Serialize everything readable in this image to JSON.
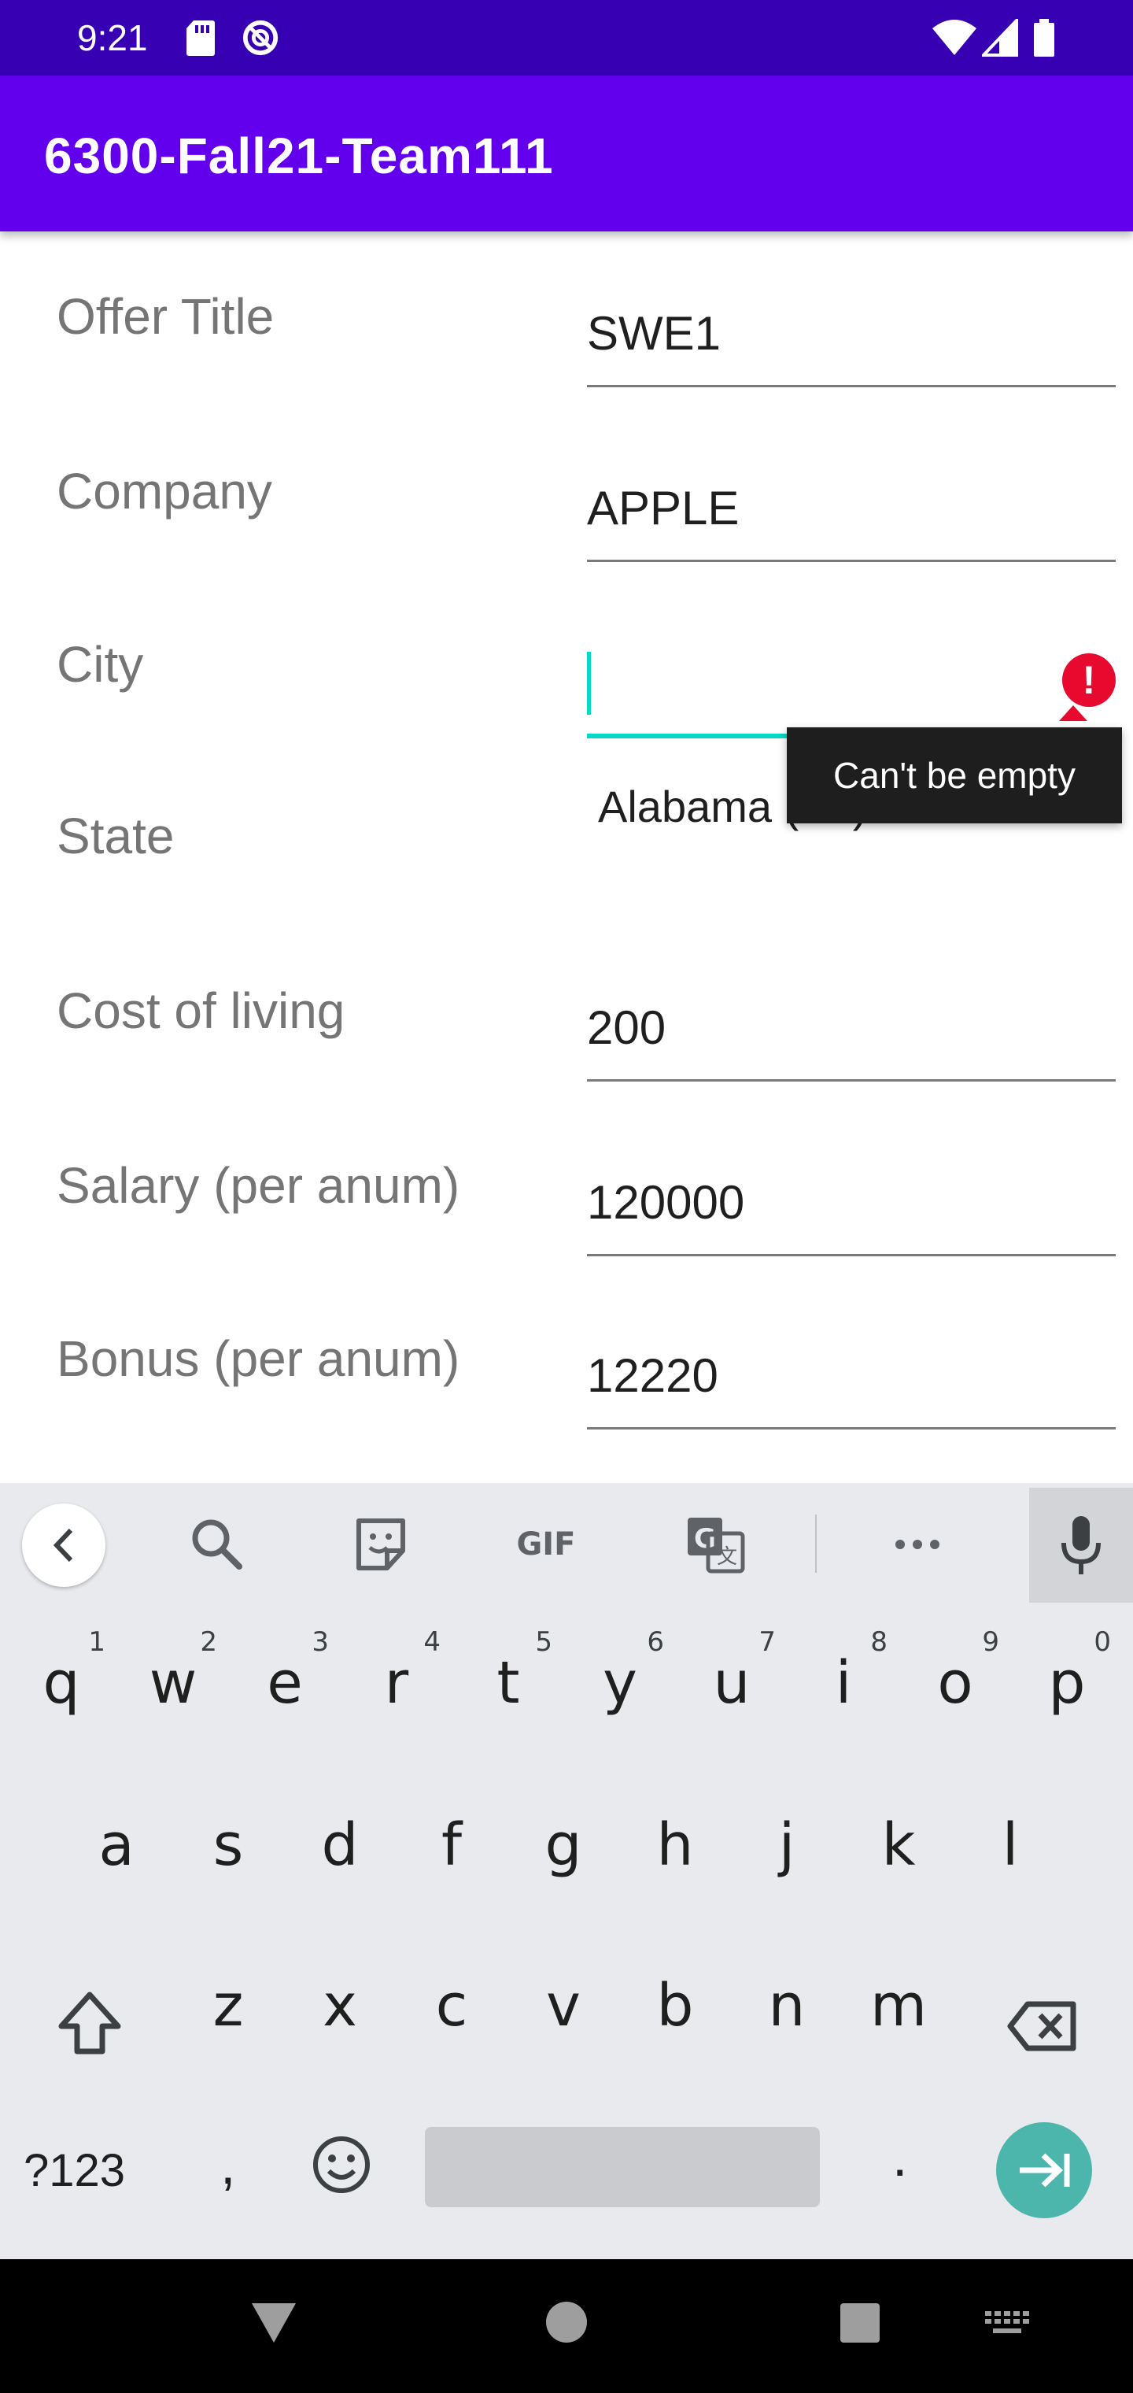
{
  "status_bar": {
    "time": "9:21",
    "left_icons": [
      "sd-card-icon",
      "do-not-disturb-icon"
    ],
    "right_icons": [
      "wifi-icon",
      "cell-signal-icon",
      "battery-icon"
    ]
  },
  "app_bar": {
    "title": "6300-Fall21-Team111"
  },
  "form": {
    "offer_title": {
      "label": "Offer Title",
      "value": "SWE1"
    },
    "company": {
      "label": "Company",
      "value": "APPLE"
    },
    "city": {
      "label": "City",
      "value": "",
      "error": "Can't be empty",
      "error_icon_glyph": "!"
    },
    "state": {
      "label": "State",
      "value": "Alabama (AL)"
    },
    "cost_of_living": {
      "label": "Cost of living",
      "value": "200"
    },
    "salary": {
      "label": "Salary (per anum)",
      "value": "120000"
    },
    "bonus": {
      "label": "Bonus (per anum)",
      "value": "12220"
    }
  },
  "keyboard": {
    "toolbar": {
      "gif_label": "GIF",
      "items": [
        "back-icon",
        "search-icon",
        "sticker-icon",
        "gif-icon",
        "translate-icon",
        "more-icon",
        "mic-icon"
      ]
    },
    "row1": [
      {
        "key": "q",
        "num": "1"
      },
      {
        "key": "w",
        "num": "2"
      },
      {
        "key": "e",
        "num": "3"
      },
      {
        "key": "r",
        "num": "4"
      },
      {
        "key": "t",
        "num": "5"
      },
      {
        "key": "y",
        "num": "6"
      },
      {
        "key": "u",
        "num": "7"
      },
      {
        "key": "i",
        "num": "8"
      },
      {
        "key": "o",
        "num": "9"
      },
      {
        "key": "p",
        "num": "0"
      }
    ],
    "row2": [
      "a",
      "s",
      "d",
      "f",
      "g",
      "h",
      "j",
      "k",
      "l"
    ],
    "row3": [
      "z",
      "x",
      "c",
      "v",
      "b",
      "n",
      "m"
    ],
    "bottom": {
      "symbols": "?123",
      "comma": ",",
      "period": "."
    }
  },
  "colors": {
    "status_bar": "#3700B3",
    "app_bar": "#6200EE",
    "accent_teal": "#03DAC5",
    "error_red": "#E8092E",
    "enter_key": "#4DB6AC"
  }
}
